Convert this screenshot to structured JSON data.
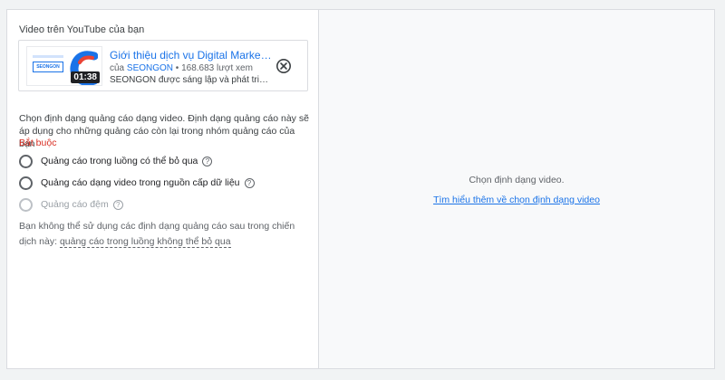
{
  "video_section": {
    "title": "Video trên YouTube của bạn",
    "video": {
      "title": "Giới thiệu dịch vụ Digital Marketi...",
      "meta_prefix": "của ",
      "channel": "SEONGON",
      "meta_suffix": " • 168.683 lượt xem",
      "description": "SEONGON được sáng lập và phát triển b...",
      "duration": "01:38",
      "thumb_brand": "SEONGON"
    }
  },
  "format_section": {
    "description": "Chọn định dạng quảng cáo dạng video. Định dạng quảng cáo này sẽ áp dụng cho những quảng cáo còn lại trong nhóm quảng cáo của bạn",
    "required_label": "Bắt buộc",
    "options": [
      {
        "label": "Quảng cáo trong luồng có thể bỏ qua",
        "disabled": false
      },
      {
        "label": "Quảng cáo dạng video trong nguồn cấp dữ liệu",
        "disabled": false
      },
      {
        "label": "Quảng cáo đệm",
        "disabled": true
      }
    ],
    "unavailable_prefix": "Bạn không thể sử dụng các định dạng quảng cáo sau trong chiến dịch này: ",
    "unavailable_link": "quảng cáo trong luồng không thể bỏ qua"
  },
  "preview_panel": {
    "message": "Chọn định dạng video.",
    "learn_more": "Tìm hiểu thêm về chọn định dạng video"
  },
  "colors": {
    "accent": "#1a73e8",
    "required": "#d93025",
    "panel_background": "#f8f9fa"
  },
  "icons": {
    "remove": "close-circle-icon",
    "help": "help-circle-icon"
  }
}
